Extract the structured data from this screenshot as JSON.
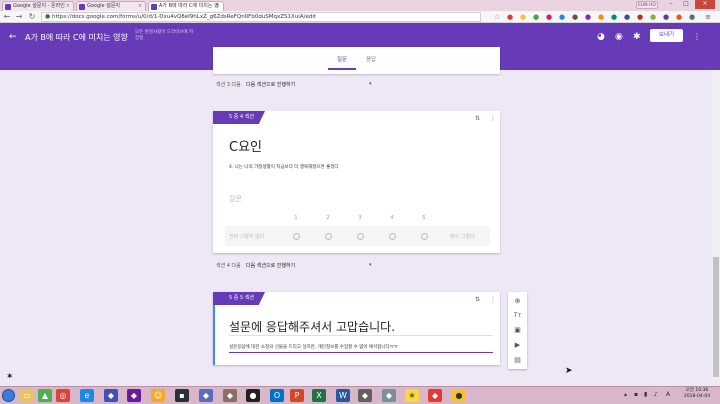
{
  "browser": {
    "tabs": [
      {
        "label": "Google 설문지 - 온라인"
      },
      {
        "label": "Google 설문지"
      },
      {
        "label": "A가 B에 따라 C에 미치는 영"
      }
    ],
    "user_chip": "EUN HO",
    "url": "https://docs.google.com/forms/u/0/d/1-Dxu4vQ8eI9hLxZ_g6ZdsReFQn0Fb0duSMqxZS1XuiA/edit"
  },
  "form": {
    "title": "A가 B에 따라 C에 미치는 영향",
    "saved_note": "모든 변경사항이 드라이브에 저장됨",
    "send_label": "보내기",
    "tabs": {
      "questions": "질문",
      "responses": "응답"
    },
    "section3_after": {
      "prefix": "섹션 3 다음",
      "value": "다음 섹션으로 진행하기"
    },
    "section4": {
      "tag": "5 중 4 섹션",
      "title": "C요인",
      "description": "4. 나는 나의 가정생활이 지금보다 더 행복해졌으면 좋겠다",
      "question_placeholder": "질문",
      "scale_numbers": [
        "1",
        "2",
        "3",
        "4",
        "5"
      ],
      "scale_low": "전혀 그렇지 않다",
      "scale_high": "매우 그렇다"
    },
    "section4_after": {
      "prefix": "섹션 4 다음",
      "value": "다음 섹션으로 진행하기"
    },
    "section5": {
      "tag": "5 중 5 섹션",
      "title": "설문에 응답해주셔서 고맙습니다.",
      "description": "설문응답에 대한 소정의 선물을 드리고 싶지만, 개인정보를 수집할 수 없어 애석합니다ㅠㅠ"
    }
  },
  "taskbar": {
    "clock_time": "오전 10:36",
    "clock_date": "2018-04-04"
  },
  "colors": {
    "accent": "#673ab7",
    "focus": "#4285f4"
  }
}
